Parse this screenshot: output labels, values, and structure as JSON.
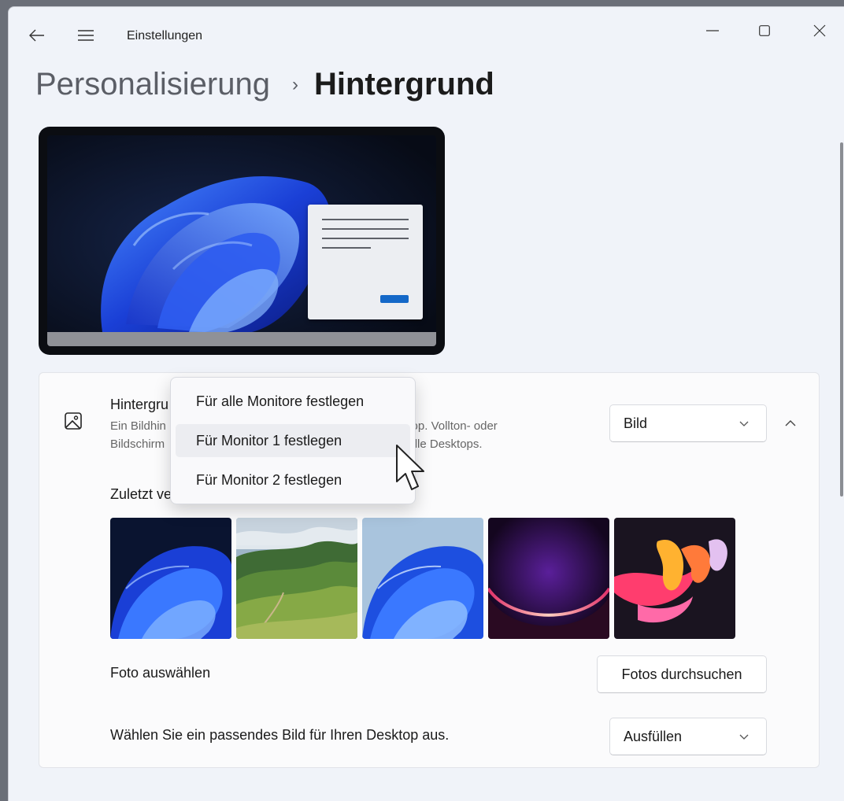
{
  "window": {
    "app_title": "Einstellungen",
    "controls": {
      "minimize": "minimize-icon",
      "maximize": "maximize-icon",
      "close": "close-icon"
    },
    "nav": {
      "back": "back-arrow-icon",
      "menu": "hamburger-menu-icon"
    }
  },
  "breadcrumb": {
    "parent": "Personalisierung",
    "separator": "›",
    "current": "Hintergrund"
  },
  "background_card": {
    "icon": "picture-icon",
    "title": "Hintergru",
    "desc_line1_left": "Ein Bildhin",
    "desc_line1_right": "ktop. Vollton- oder",
    "desc_line2_left": "Bildschirm",
    "desc_line2_right": "r alle Desktops.",
    "type_select": {
      "value": "Bild",
      "icon": "chevron-down-icon"
    },
    "collapse_icon": "chevron-up-icon"
  },
  "recent": {
    "label": "Zuletzt ve",
    "images": [
      "bloom-dark-wallpaper",
      "green-hills-landscape",
      "bloom-light-wallpaper",
      "purple-glow-wallpaper",
      "colorful-ribbons-wallpaper"
    ]
  },
  "choose_photo": {
    "label": "Foto auswählen",
    "button": "Fotos durchsuchen"
  },
  "fit": {
    "label": "Wählen Sie ein passendes Bild für Ihren Desktop aus.",
    "value": "Ausfüllen"
  },
  "context_menu": {
    "items": [
      {
        "label": "Für alle Monitore festlegen"
      },
      {
        "label": "Für Monitor 1 festlegen"
      },
      {
        "label": "Für Monitor 2 festlegen"
      }
    ],
    "hovered_index": 1
  },
  "colors": {
    "accent": "#1468c8",
    "window_bg": "#f0f3f9",
    "card_bg": "#fbfbfc"
  }
}
